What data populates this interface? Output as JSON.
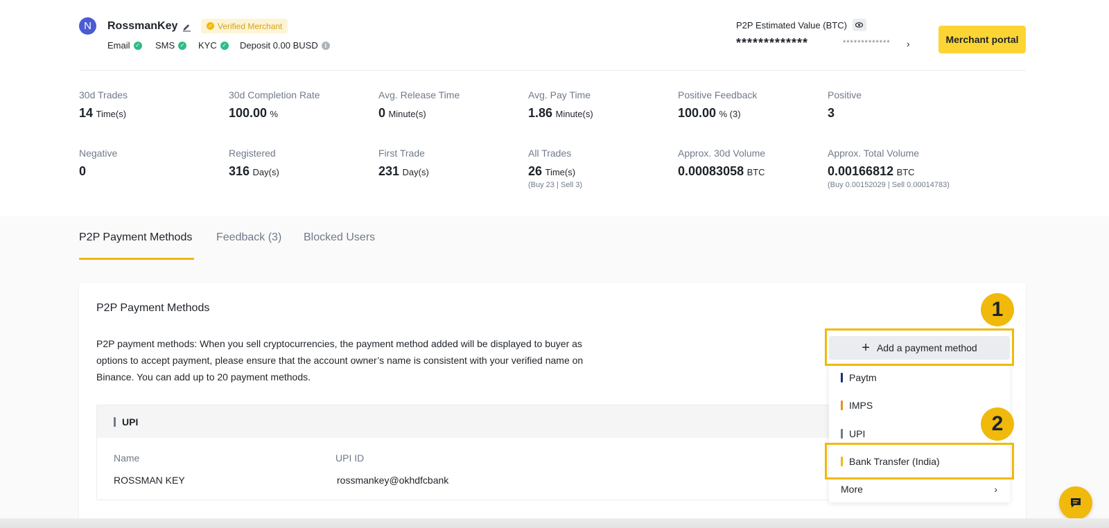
{
  "profile": {
    "avatar_letter": "N",
    "username": "RossmanKey",
    "badge": "Verified Merchant",
    "email": "Email",
    "sms": "SMS",
    "kyc": "KYC",
    "deposit": "Deposit 0.00 BUSD"
  },
  "estimate": {
    "label": "P2P Estimated Value (BTC)",
    "masked_value": "*************",
    "masked_secondary": "*************",
    "merchant_button": "Merchant portal"
  },
  "stats": [
    {
      "label": "30d Trades",
      "value": "14",
      "unit": "Time(s)",
      "sub": ""
    },
    {
      "label": "30d Completion Rate",
      "value": "100.00",
      "unit": "%",
      "sub": ""
    },
    {
      "label": "Avg. Release Time",
      "value": "0",
      "unit": "Minute(s)",
      "sub": ""
    },
    {
      "label": "Avg. Pay Time",
      "value": "1.86",
      "unit": "Minute(s)",
      "sub": ""
    },
    {
      "label": "Positive Feedback",
      "value": "100.00",
      "unit": "% (3)",
      "sub": ""
    },
    {
      "label": "Positive",
      "value": "3",
      "unit": "",
      "sub": ""
    },
    {
      "label": "Negative",
      "value": "0",
      "unit": "",
      "sub": ""
    },
    {
      "label": "Registered",
      "value": "316",
      "unit": "Day(s)",
      "sub": ""
    },
    {
      "label": "First Trade",
      "value": "231",
      "unit": "Day(s)",
      "sub": ""
    },
    {
      "label": "All Trades",
      "value": "26",
      "unit": "Time(s)",
      "sub": "(Buy 23 | Sell 3)"
    },
    {
      "label": "Approx. 30d Volume",
      "value": "0.00083058",
      "unit": "BTC",
      "sub": ""
    },
    {
      "label": "Approx. Total Volume",
      "value": "0.00166812",
      "unit": "BTC",
      "sub": "(Buy 0.00152029 | Sell 0.00014783)"
    }
  ],
  "tabs": [
    "P2P Payment Methods",
    "Feedback (3)",
    "Blocked Users"
  ],
  "card": {
    "title": "P2P Payment Methods",
    "description": "P2P payment methods: When you sell cryptocurrencies, the payment method added will be displayed to buyer as options to accept payment, please ensure that the account owner’s name is consistent with your verified name on Binance. You can add up to 20 payment methods."
  },
  "upi": {
    "title": "UPI",
    "name_label": "Name",
    "name_value": "ROSSMAN KEY",
    "id_label": "UPI ID",
    "id_value": "rossmankey@okhdfcbank"
  },
  "add_button": "Add a payment method",
  "menu": [
    {
      "label": "Paytm",
      "color": "#1a2f7a"
    },
    {
      "label": "IMPS",
      "color": "#f08a24"
    },
    {
      "label": "UPI",
      "color": "#707a8a"
    },
    {
      "label": "Bank Transfer (India)",
      "color": "#f0b90b"
    }
  ],
  "more": "More",
  "steps": [
    "1",
    "2"
  ],
  "colors": {
    "accent": "#f0b90b",
    "success": "#2ebd85",
    "text": "#1e2329",
    "muted": "#707a8a"
  }
}
